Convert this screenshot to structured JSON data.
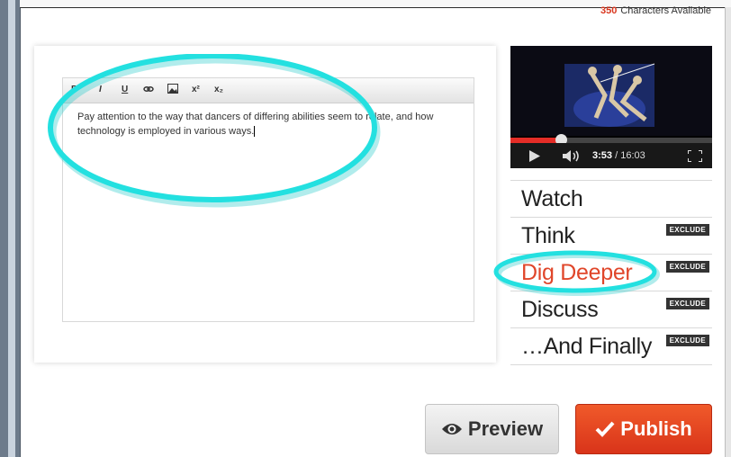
{
  "header": {
    "char_count_number": "350",
    "char_count_label": "Characters Available"
  },
  "editor": {
    "toolbar": {
      "bold": "B",
      "italic": "I",
      "underline": "U",
      "superscript": "x²",
      "subscript": "x₂"
    },
    "text": "Pay attention to the way that dancers of differing abilities seem to relate, and how technology is employed in various ways."
  },
  "video": {
    "current_time": "3:53",
    "separator": " / ",
    "duration": "16:03",
    "progress": 0.25
  },
  "menu": {
    "items": [
      {
        "label": "Watch",
        "exclude": ""
      },
      {
        "label": "Think",
        "exclude": "EXCLUDE"
      },
      {
        "label": "Dig Deeper",
        "exclude": "EXCLUDE"
      },
      {
        "label": "Discuss",
        "exclude": "EXCLUDE"
      },
      {
        "label": "…And Finally",
        "exclude": "EXCLUDE"
      }
    ],
    "active_index": 2
  },
  "actions": {
    "preview_label": "Preview",
    "publish_label": "Publish"
  },
  "colors": {
    "accent": "#e0462a",
    "annotation": "#23e0e0"
  }
}
